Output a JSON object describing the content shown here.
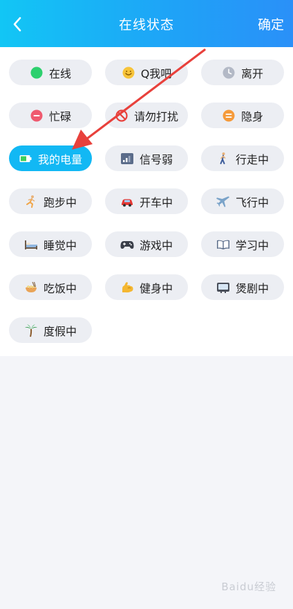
{
  "header": {
    "title": "在线状态",
    "confirm_label": "确定",
    "bg_color": "#1fa2f7"
  },
  "statuses": [
    {
      "label": "在线",
      "icon": "online-dot-icon"
    },
    {
      "label": "Q我吧",
      "icon": "smiley-face-icon"
    },
    {
      "label": "离开",
      "icon": "clock-icon"
    },
    {
      "label": "忙碌",
      "icon": "busy-minus-icon"
    },
    {
      "label": "请勿打扰",
      "icon": "do-not-disturb-icon"
    },
    {
      "label": "隐身",
      "icon": "invisible-icon"
    },
    {
      "label": "我的电量",
      "icon": "battery-icon",
      "selected": true
    },
    {
      "label": "信号弱",
      "icon": "weak-signal-icon"
    },
    {
      "label": "行走中",
      "icon": "walking-person-icon"
    },
    {
      "label": "跑步中",
      "icon": "running-person-icon"
    },
    {
      "label": "开车中",
      "icon": "car-icon"
    },
    {
      "label": "飞行中",
      "icon": "airplane-icon"
    },
    {
      "label": "睡觉中",
      "icon": "bed-icon"
    },
    {
      "label": "游戏中",
      "icon": "gamepad-icon"
    },
    {
      "label": "学习中",
      "icon": "book-icon"
    },
    {
      "label": "吃饭中",
      "icon": "noodle-bowl-icon"
    },
    {
      "label": "健身中",
      "icon": "flexed-bicep-icon"
    },
    {
      "label": "煲剧中",
      "icon": "tv-icon"
    },
    {
      "label": "度假中",
      "icon": "palm-tree-icon"
    }
  ],
  "colors": {
    "selected_pill": "#12b8f4",
    "pill": "#eceef3",
    "arrow": "#e8413c"
  },
  "watermark": "Baidu经验"
}
